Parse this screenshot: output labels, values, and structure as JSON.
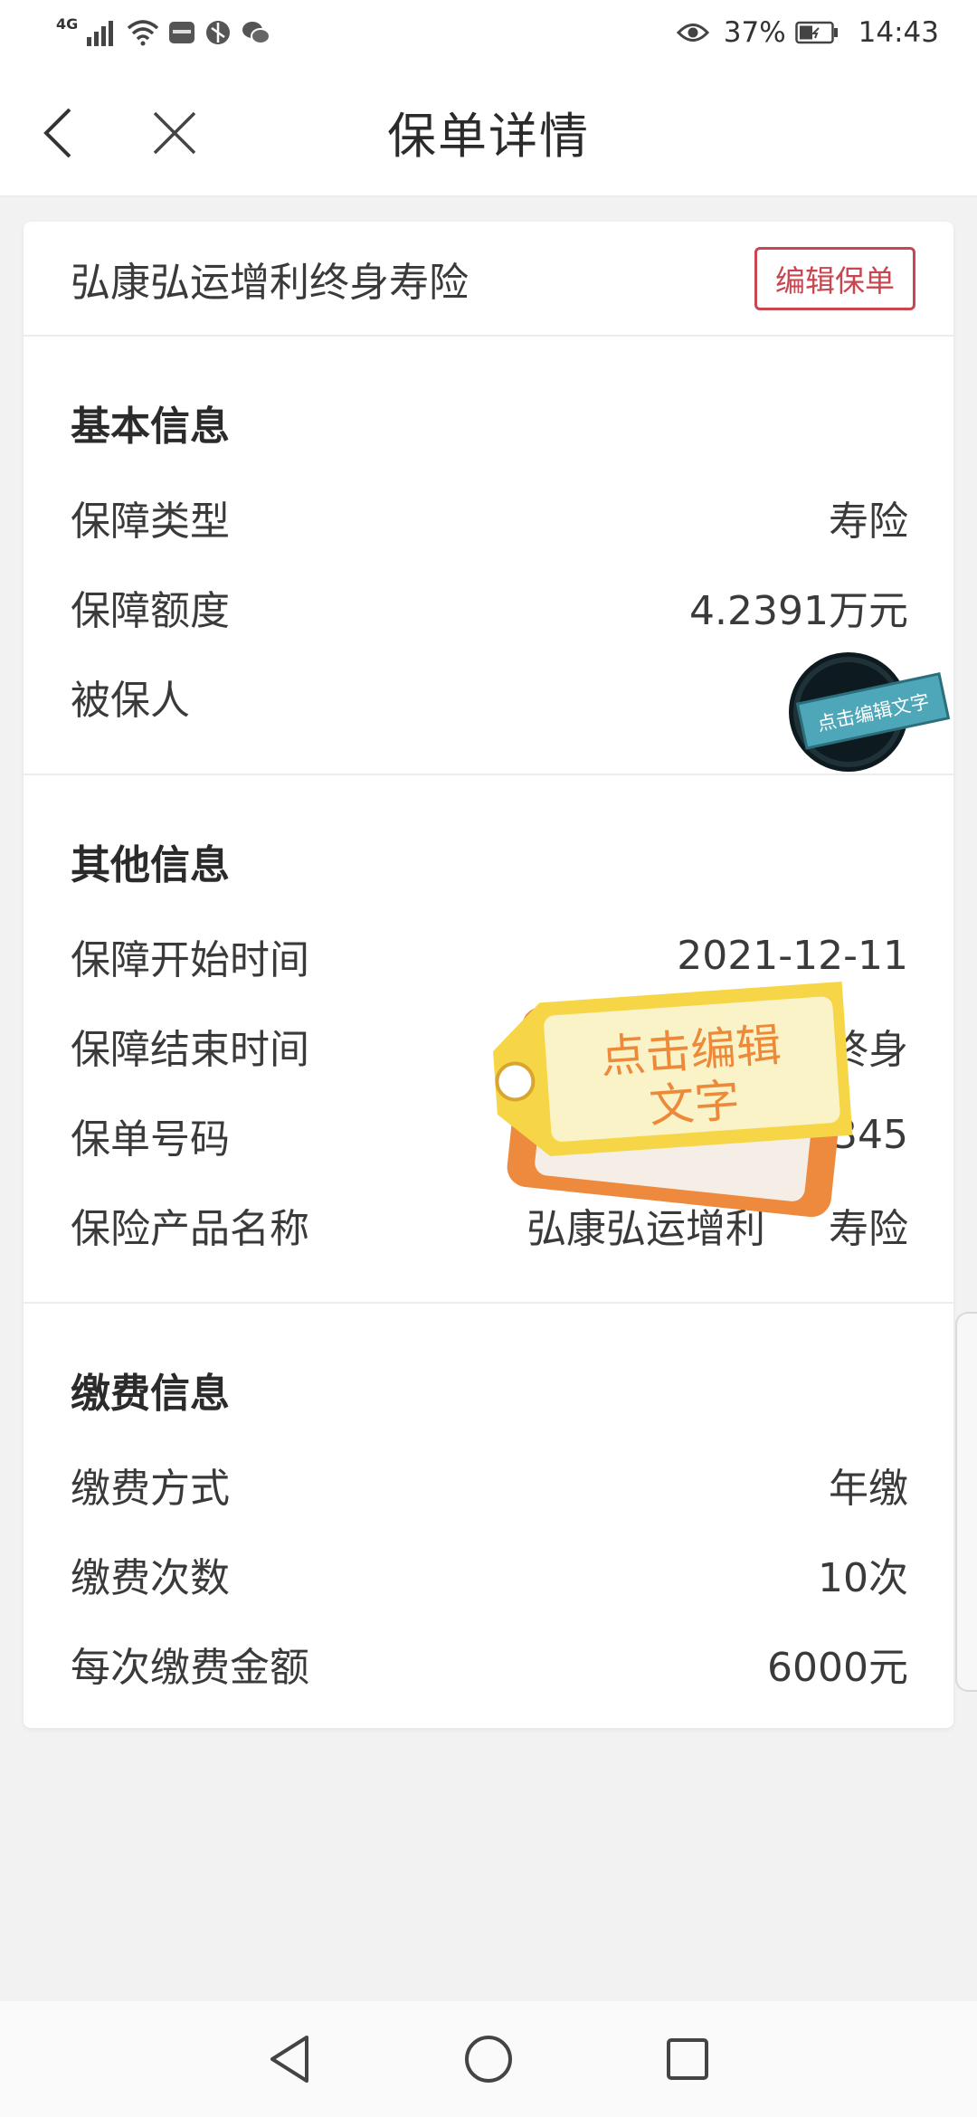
{
  "status_bar": {
    "network": "4G",
    "battery": "37%",
    "time": "14:43",
    "icons": [
      "signal-icon",
      "wifi-icon",
      "huawei-icon",
      "app-icon",
      "wechat-icon",
      "eye-icon",
      "battery-icon"
    ]
  },
  "header": {
    "title": "保单详情",
    "back_icon": "back-chevron-icon",
    "close_icon": "close-icon"
  },
  "policy": {
    "name": "弘康弘运增利终身寿险",
    "edit_label": "编辑保单",
    "edit_color": "#c8464f"
  },
  "sections": {
    "basic": {
      "title": "基本信息",
      "rows": [
        {
          "label": "保障类型",
          "value": "寿险"
        },
        {
          "label": "保障额度",
          "value": "4.2391万元"
        },
        {
          "label": "被保人",
          "value": ""
        }
      ]
    },
    "other": {
      "title": "其他信息",
      "rows": [
        {
          "label": "保障开始时间",
          "value": "2021-12-11"
        },
        {
          "label": "保障结束时间",
          "value": "终身"
        },
        {
          "label": "保单号码",
          "value": "86                345"
        },
        {
          "label": "保险产品名称",
          "value": "弘康弘运增利     寿险"
        }
      ]
    },
    "payment": {
      "title": "缴费信息",
      "rows": [
        {
          "label": "缴费方式",
          "value": "年缴"
        },
        {
          "label": "缴费次数",
          "value": "10次"
        },
        {
          "label": "每次缴费金额",
          "value": "6000元"
        }
      ]
    }
  },
  "stickers": {
    "round_text": "点击编辑文字",
    "tag_line1": "点击编辑",
    "tag_line2": "文字"
  },
  "nav": {
    "back": "triangle-back-icon",
    "home": "circle-home-icon",
    "recent": "square-recent-icon"
  }
}
